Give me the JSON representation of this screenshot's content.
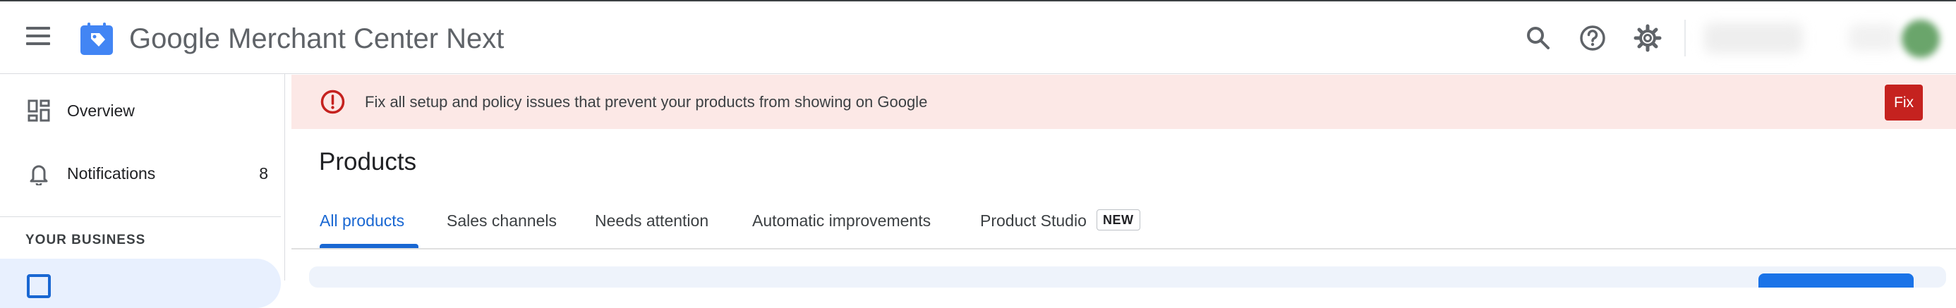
{
  "header": {
    "brand": "Google",
    "product": "Merchant Center Next",
    "icons": [
      "menu-icon",
      "search-icon",
      "help-icon",
      "gear-icon"
    ]
  },
  "sidebar": {
    "items": [
      {
        "label": "Overview",
        "icon": "overview-icon"
      },
      {
        "label": "Notifications",
        "icon": "bell-icon",
        "count": "8"
      }
    ],
    "section_heading": "YOUR BUSINESS"
  },
  "banner": {
    "message": "Fix all setup and policy issues that prevent your products from showing on Google",
    "button_label": "Fix",
    "color": "#fce8e6",
    "accent": "#c5221f"
  },
  "main": {
    "title": "Products",
    "tabs": [
      {
        "label": "All products",
        "active": true
      },
      {
        "label": "Sales channels"
      },
      {
        "label": "Needs attention"
      },
      {
        "label": "Automatic improvements"
      },
      {
        "label": "Product Studio",
        "badge": "NEW"
      }
    ]
  },
  "colors": {
    "accent_blue": "#1967d2",
    "selected_nav_bg": "#e8f0fe"
  }
}
